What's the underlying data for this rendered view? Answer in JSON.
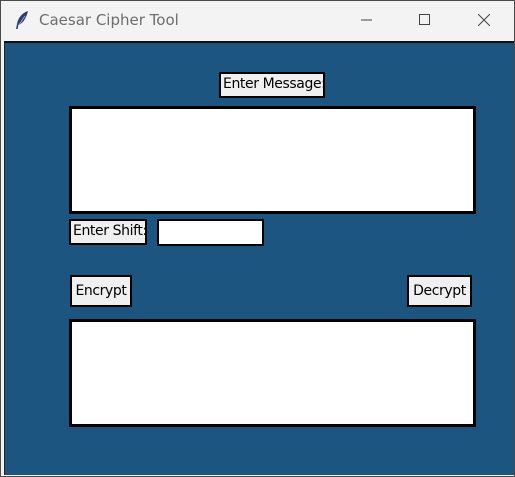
{
  "window": {
    "title": "Caesar Cipher Tool"
  },
  "icons": {
    "app": "feather-icon",
    "minimize": "minimize-icon",
    "maximize": "maximize-icon",
    "close": "close-icon"
  },
  "form": {
    "message_label": "Enter Message:",
    "message_value": "",
    "shift_label": "Enter Shift:",
    "shift_value": "",
    "encrypt_label": "Encrypt",
    "decrypt_label": "Decrypt",
    "result_value": ""
  },
  "colors": {
    "background": "#1b5580",
    "widget_bg": "#f0f0f0",
    "titlebar": "#f3f3f3"
  }
}
